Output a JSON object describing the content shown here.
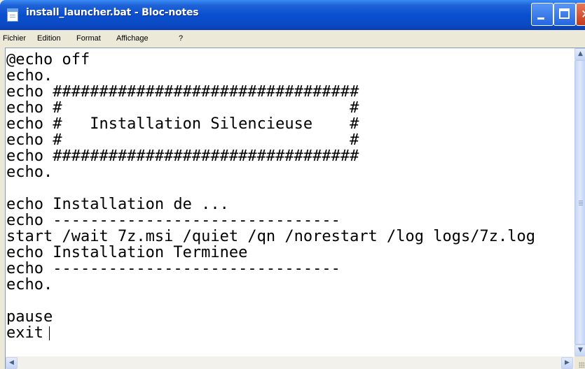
{
  "window": {
    "title": "install_launcher.bat - Bloc-notes",
    "app_icon": "notepad-icon",
    "controls": [
      "minimize-icon",
      "maximize-icon",
      "close-icon"
    ],
    "titlebar_color": "#0a4fd0"
  },
  "menu": {
    "items": [
      {
        "label": "Fichier"
      },
      {
        "label": "Edition"
      },
      {
        "label": "Format"
      },
      {
        "label": "Affichage"
      },
      {
        "label": "?"
      }
    ]
  },
  "editor": {
    "lines": [
      "@echo off",
      "echo.",
      "echo #################################",
      "echo #                               #",
      "echo #   Installation Silencieuse    #",
      "echo #                               #",
      "echo #################################",
      "echo.",
      "",
      "echo Installation de ...",
      "echo -------------------------------",
      "start /wait 7z.msi /quiet /qn /norestart /log logs/7z.log",
      "echo Installation Terminee",
      "echo -------------------------------",
      "echo.",
      "",
      "pause",
      "exit"
    ]
  }
}
